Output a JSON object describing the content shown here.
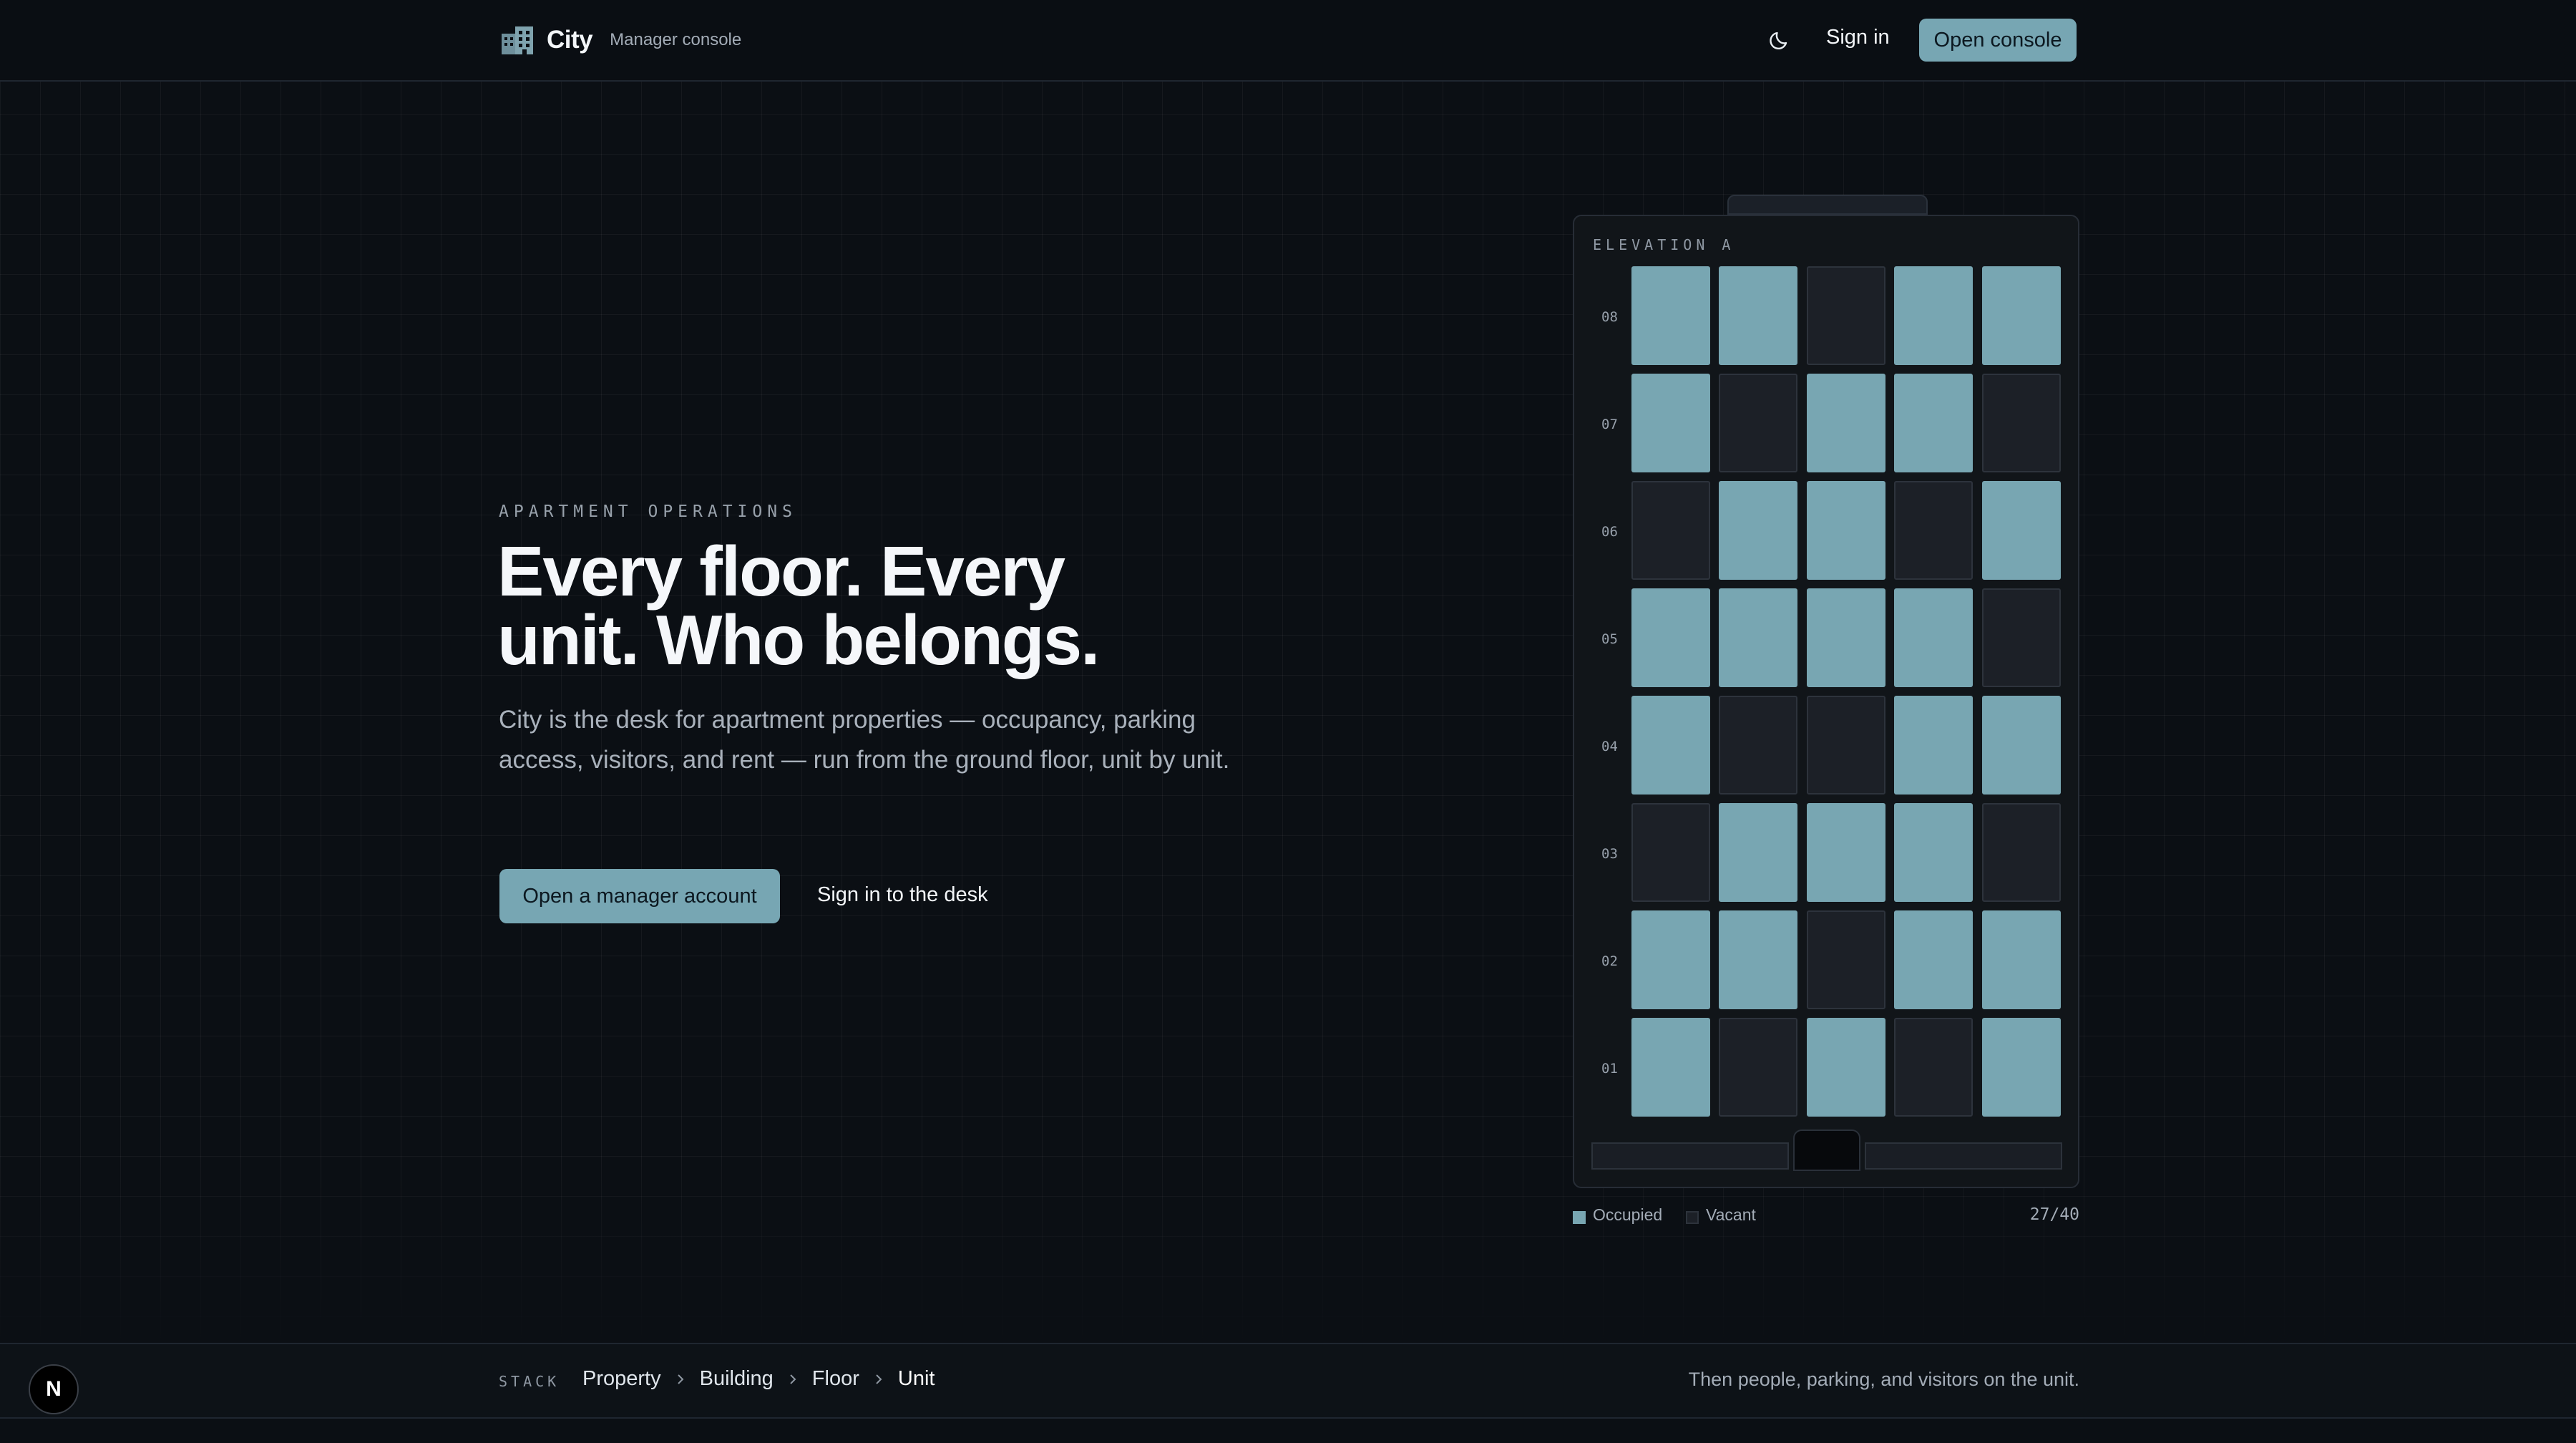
{
  "header": {
    "brand_name": "City",
    "brand_subtitle": "Manager console",
    "brand_icon": "building-icon",
    "theme_icon": "moon-icon",
    "sign_in_label": "Sign in",
    "open_console_label": "Open console"
  },
  "hero": {
    "eyebrow": "APARTMENT OPERATIONS",
    "headline": "Every floor. Every unit. Who belongs.",
    "lede": "City is the desk for apartment properties — occupancy, parking access, visitors, and rent — run from the ground floor, unit by unit.",
    "primary_cta": "Open a manager account",
    "secondary_cta": "Sign in to the desk"
  },
  "building": {
    "label": "ELEVATION A",
    "floors": [
      {
        "number": "08",
        "units": [
          true,
          true,
          false,
          true,
          true
        ]
      },
      {
        "number": "07",
        "units": [
          true,
          false,
          true,
          true,
          false
        ]
      },
      {
        "number": "06",
        "units": [
          false,
          true,
          true,
          false,
          true
        ]
      },
      {
        "number": "05",
        "units": [
          true,
          true,
          true,
          true,
          false
        ]
      },
      {
        "number": "04",
        "units": [
          true,
          false,
          false,
          true,
          true
        ]
      },
      {
        "number": "03",
        "units": [
          false,
          true,
          true,
          true,
          false
        ]
      },
      {
        "number": "02",
        "units": [
          true,
          true,
          false,
          true,
          true
        ]
      },
      {
        "number": "01",
        "units": [
          true,
          false,
          true,
          false,
          true
        ]
      }
    ],
    "legend": {
      "occupied_label": "Occupied",
      "vacant_label": "Vacant",
      "count": "27/40"
    },
    "colors": {
      "occupied": "#78a6b2",
      "vacant": "#1c2027"
    }
  },
  "footer": {
    "stack_label": "STACK",
    "breadcrumbs": [
      "Property",
      "Building",
      "Floor",
      "Unit"
    ],
    "note": "Then people, parking, and visitors on the unit."
  },
  "badge": {
    "letter": "N"
  },
  "colors": {
    "accent": "#77a6b3",
    "background": "#0b0f14"
  }
}
